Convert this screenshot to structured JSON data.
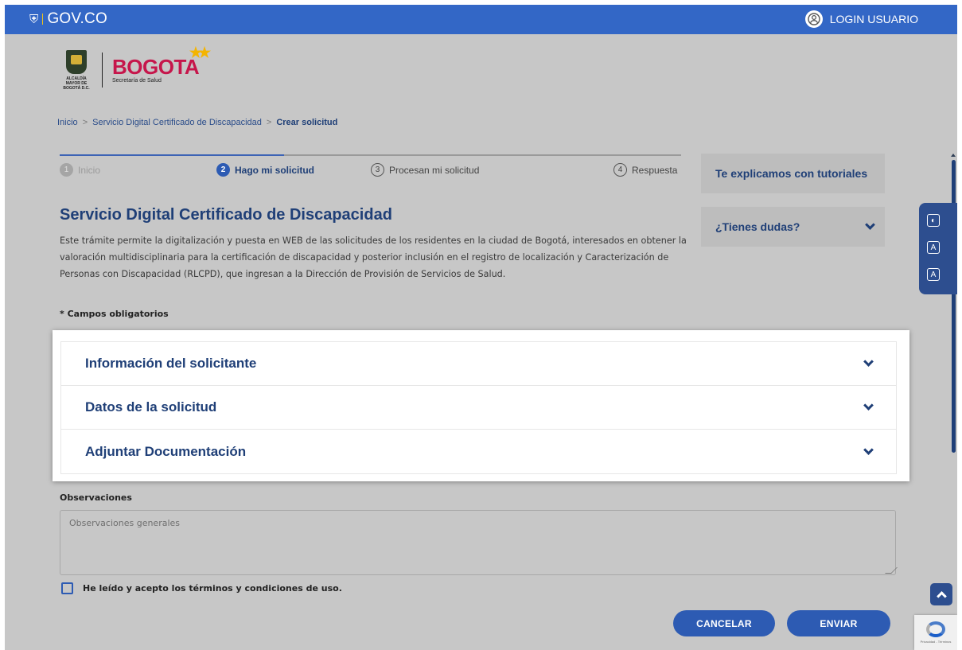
{
  "topbar": {
    "logo_text": "GOV.CO",
    "login_label": "LOGIN USUARIO"
  },
  "logos": {
    "alcaldia_text": "ALCALDÍA MAYOR DE BOGOTÁ D.C.",
    "bogota_name": "BOGOTA",
    "bogota_sub": "Secretaría de Salud"
  },
  "breadcrumb": {
    "items": [
      "Inicio",
      "Servicio Digital Certificado de Discapacidad",
      "Crear solicitud"
    ],
    "separator": ">"
  },
  "stepper": {
    "steps": [
      {
        "num": "1",
        "label": "Inicio"
      },
      {
        "num": "2",
        "label": "Hago mi solicitud"
      },
      {
        "num": "3",
        "label": "Procesan mi solicitud"
      },
      {
        "num": "4",
        "label": "Respuesta"
      }
    ]
  },
  "main": {
    "title": "Servicio Digital Certificado de Discapacidad",
    "description": "Este trámite permite la digitalización y puesta en WEB de las solicitudes de los residentes en la ciudad de Bogotá, interesados en obtener la valoración multidisciplinaria para la certificación de discapacidad y posterior inclusión en el registro de localización y Caracterización de Personas con Discapacidad (RLCPD), que ingresan a la Dirección de Provisión de Servicios de Salud.",
    "required_note": "* Campos obligatorios"
  },
  "sidebar": {
    "tutorials": "Te explicamos con tutoriales",
    "questions": "¿Tienes dudas?"
  },
  "accordion": {
    "sections": [
      {
        "label": "Información del solicitante"
      },
      {
        "label": "Datos de la solicitud"
      },
      {
        "label": "Adjuntar Documentación"
      }
    ]
  },
  "form": {
    "observations_label": "Observaciones",
    "observations_placeholder": "Observaciones generales",
    "terms_label": "He leído y acepto los términos y condiciones de uso.",
    "cancel_label": "CANCELAR",
    "submit_label": "ENVIAR"
  },
  "accessibility": {
    "contrast": "◐",
    "font_decrease": "A",
    "font_increase": "A"
  },
  "recaptcha": {
    "text": "Privacidad - Términos"
  },
  "colors": {
    "topbar": "#3367c6",
    "primary": "#2d5bb3",
    "title": "#1f3f77",
    "brand_red": "#c6164b",
    "overlay_bg": "#c7c7c7"
  }
}
